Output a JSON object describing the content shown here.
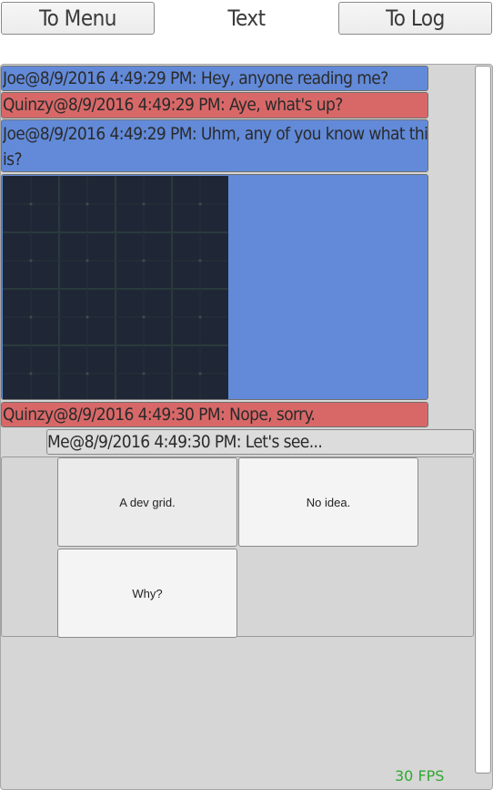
{
  "topbar": {
    "menu_button": "To Menu",
    "title": "Text",
    "log_button": "To Log"
  },
  "messages": [
    {
      "sender": "Joe",
      "timestamp": "8/9/2016 4:49:29 PM",
      "text": "Hey, anyone reading me?",
      "color": "#628ad9"
    },
    {
      "sender": "Quinzy",
      "timestamp": "8/9/2016 4:49:29 PM",
      "text": "Aye, what's up?",
      "color": "#d86868"
    },
    {
      "sender": "Joe",
      "timestamp": "8/9/2016 4:49:29 PM",
      "line1": "Uhm, any of you know what this",
      "line2": "is?",
      "color": "#628ad9"
    },
    {
      "sender": "Quinzy",
      "timestamp": "8/9/2016 4:49:30 PM",
      "text": "Nope, sorry.",
      "color": "#d86868"
    }
  ],
  "image_message": {
    "icon": "dev-grid-image",
    "background": "#1f2736"
  },
  "my_message": {
    "sender": "Me",
    "timestamp": "8/9/2016 4:49:30 PM",
    "text": "Let's see..."
  },
  "choices": [
    "A dev grid.",
    "No idea.",
    "Why?"
  ],
  "fps": "30 FPS",
  "colors": {
    "player_blue": "#628ad9",
    "player_red": "#d86868",
    "fps_green": "#2fa82f"
  }
}
